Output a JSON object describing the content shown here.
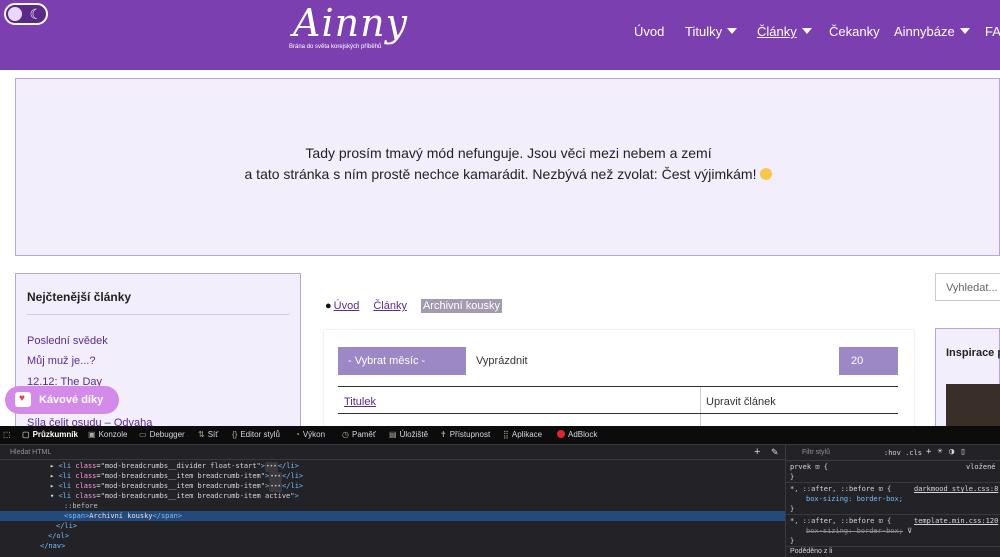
{
  "header": {
    "logo_text": "Ainny",
    "logo_tagline": "Brána do světa korejských příběhů",
    "nav": [
      {
        "label": "Úvod",
        "dropdown": false,
        "active": false
      },
      {
        "label": "Titulky",
        "dropdown": true,
        "active": false
      },
      {
        "label": "Články",
        "dropdown": true,
        "active": true
      },
      {
        "label": "Čekanky",
        "dropdown": false,
        "active": false
      },
      {
        "label": "Ainnybáze",
        "dropdown": true,
        "active": false
      },
      {
        "label": "FAQ",
        "dropdown": false,
        "active": false
      }
    ]
  },
  "notice": {
    "line1": "Tady prosím tmavý mód nefunguje. Jsou věci mezi nebem a zemí",
    "line2": "a tato stránka s ním prostě nechce kamarádit. Nezbývá než zvolat: Čest výjimkám!"
  },
  "sidebar": {
    "title": "Nejčtenější články",
    "items": [
      "Poslední svědek",
      "Můj muž je...?",
      "12.12: The Day",
      "Síla čelit osudu – Odvaha"
    ]
  },
  "coffee": {
    "label": "Kávové díky"
  },
  "breadcrumb": {
    "home": "Úvod",
    "section": "Články",
    "current": "Archivní kousky"
  },
  "filters": {
    "month_button": "- Vybrat měsíc -",
    "clear_button": "Vyprázdnit",
    "limit_value": "20"
  },
  "table": {
    "col_title": "Titulek",
    "col_edit": "Upravit článek"
  },
  "right": {
    "search_placeholder": "Vyhledat...",
    "inspiration_title": "Inspirace p"
  },
  "devtools": {
    "tabs": [
      "Průzkumník",
      "Konzole",
      "Debugger",
      "Síť",
      "Editor stylů",
      "Výkon",
      "Paměť",
      "Úložiště",
      "Přístupnost",
      "Aplikace",
      "AdBlock"
    ],
    "search_placeholder": "Hledat HTML",
    "code_lines": [
      {
        "kind": "li",
        "cls": "mod-breadcrumbs__divider float-start"
      },
      {
        "kind": "li",
        "cls": "mod-breadcrumbs__item breadcrumb-item"
      },
      {
        "kind": "li",
        "cls": "mod-breadcrumbs__item breadcrumb-item"
      },
      {
        "kind": "li-open",
        "cls": "mod-breadcrumbs__item breadcrumb-item active"
      },
      {
        "kind": "pseudo",
        "text": "::before"
      },
      {
        "kind": "span",
        "text": "Archivní kousky"
      },
      {
        "kind": "close",
        "text": "</li>"
      },
      {
        "kind": "close",
        "text": "</ol>"
      },
      {
        "kind": "close",
        "text": "</nav>"
      }
    ],
    "rules": {
      "filter_placeholder": "Filtr stylů",
      "hov": ":hov .cls",
      "element_selector": "prvek",
      "element_source": "vložené",
      "rule1_selector": "*, ::after, ::before",
      "rule1_source": "darkmood_style.css:8",
      "rule1_decl": "box-sizing: border-box;",
      "rule2_selector": "*, ::after, ::before",
      "rule2_source": "template.min.css:120",
      "rule2_decl": "box-sizing: border-box;",
      "inherited": "Poděděno z li"
    }
  }
}
